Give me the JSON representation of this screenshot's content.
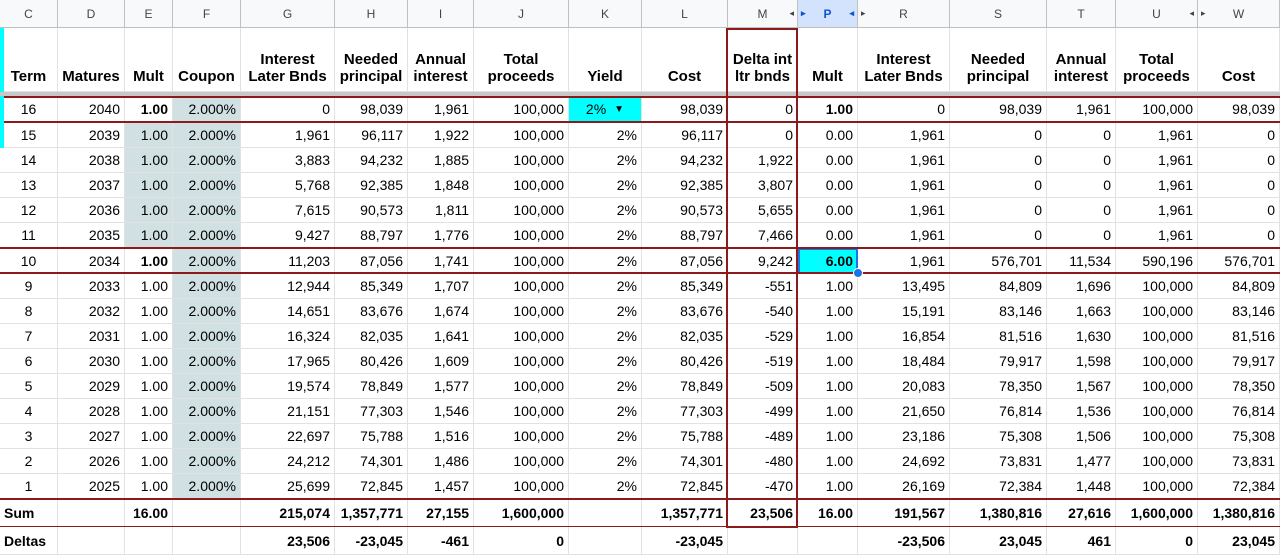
{
  "columns": [
    "C",
    "D",
    "E",
    "F",
    "G",
    "H",
    "I",
    "J",
    "K",
    "L",
    "M",
    "P",
    "R",
    "S",
    "T",
    "U",
    "W"
  ],
  "selected_column": "P",
  "headers": [
    "Term",
    "Matures",
    "Mult",
    "Coupon",
    "Interest Later Bnds",
    "Needed principal",
    "Annual interest",
    "Total proceeds",
    "Yield",
    "Cost",
    "Delta int ltr bnds",
    "Mult",
    "Interest Later Bnds",
    "Needed principal",
    "Annual interest",
    "Total proceeds",
    "Cost"
  ],
  "rows": [
    [
      "16",
      "2040",
      "1.00",
      "2.000%",
      "0",
      "98,039",
      "1,961",
      "100,000",
      "2%",
      "98,039",
      "0",
      "1.00",
      "0",
      "98,039",
      "1,961",
      "100,000",
      "98,039"
    ],
    [
      "15",
      "2039",
      "1.00",
      "2.000%",
      "1,961",
      "96,117",
      "1,922",
      "100,000",
      "2%",
      "96,117",
      "0",
      "0.00",
      "1,961",
      "0",
      "0",
      "1,961",
      "0"
    ],
    [
      "14",
      "2038",
      "1.00",
      "2.000%",
      "3,883",
      "94,232",
      "1,885",
      "100,000",
      "2%",
      "94,232",
      "1,922",
      "0.00",
      "1,961",
      "0",
      "0",
      "1,961",
      "0"
    ],
    [
      "13",
      "2037",
      "1.00",
      "2.000%",
      "5,768",
      "92,385",
      "1,848",
      "100,000",
      "2%",
      "92,385",
      "3,807",
      "0.00",
      "1,961",
      "0",
      "0",
      "1,961",
      "0"
    ],
    [
      "12",
      "2036",
      "1.00",
      "2.000%",
      "7,615",
      "90,573",
      "1,811",
      "100,000",
      "2%",
      "90,573",
      "5,655",
      "0.00",
      "1,961",
      "0",
      "0",
      "1,961",
      "0"
    ],
    [
      "11",
      "2035",
      "1.00",
      "2.000%",
      "9,427",
      "88,797",
      "1,776",
      "100,000",
      "2%",
      "88,797",
      "7,466",
      "0.00",
      "1,961",
      "0",
      "0",
      "1,961",
      "0"
    ],
    [
      "10",
      "2034",
      "1.00",
      "2.000%",
      "11,203",
      "87,056",
      "1,741",
      "100,000",
      "2%",
      "87,056",
      "9,242",
      "6.00",
      "1,961",
      "576,701",
      "11,534",
      "590,196",
      "576,701"
    ],
    [
      "9",
      "2033",
      "1.00",
      "2.000%",
      "12,944",
      "85,349",
      "1,707",
      "100,000",
      "2%",
      "85,349",
      "-551",
      "1.00",
      "13,495",
      "84,809",
      "1,696",
      "100,000",
      "84,809"
    ],
    [
      "8",
      "2032",
      "1.00",
      "2.000%",
      "14,651",
      "83,676",
      "1,674",
      "100,000",
      "2%",
      "83,676",
      "-540",
      "1.00",
      "15,191",
      "83,146",
      "1,663",
      "100,000",
      "83,146"
    ],
    [
      "7",
      "2031",
      "1.00",
      "2.000%",
      "16,324",
      "82,035",
      "1,641",
      "100,000",
      "2%",
      "82,035",
      "-529",
      "1.00",
      "16,854",
      "81,516",
      "1,630",
      "100,000",
      "81,516"
    ],
    [
      "6",
      "2030",
      "1.00",
      "2.000%",
      "17,965",
      "80,426",
      "1,609",
      "100,000",
      "2%",
      "80,426",
      "-519",
      "1.00",
      "18,484",
      "79,917",
      "1,598",
      "100,000",
      "79,917"
    ],
    [
      "5",
      "2029",
      "1.00",
      "2.000%",
      "19,574",
      "78,849",
      "1,577",
      "100,000",
      "2%",
      "78,849",
      "-509",
      "1.00",
      "20,083",
      "78,350",
      "1,567",
      "100,000",
      "78,350"
    ],
    [
      "4",
      "2028",
      "1.00",
      "2.000%",
      "21,151",
      "77,303",
      "1,546",
      "100,000",
      "2%",
      "77,303",
      "-499",
      "1.00",
      "21,650",
      "76,814",
      "1,536",
      "100,000",
      "76,814"
    ],
    [
      "3",
      "2027",
      "1.00",
      "2.000%",
      "22,697",
      "75,788",
      "1,516",
      "100,000",
      "2%",
      "75,788",
      "-489",
      "1.00",
      "23,186",
      "75,308",
      "1,506",
      "100,000",
      "75,308"
    ],
    [
      "2",
      "2026",
      "1.00",
      "2.000%",
      "24,212",
      "74,301",
      "1,486",
      "100,000",
      "2%",
      "74,301",
      "-480",
      "1.00",
      "24,692",
      "73,831",
      "1,477",
      "100,000",
      "73,831"
    ],
    [
      "1",
      "2025",
      "1.00",
      "2.000%",
      "25,699",
      "72,845",
      "1,457",
      "100,000",
      "2%",
      "72,845",
      "-470",
      "1.00",
      "26,169",
      "72,384",
      "1,448",
      "100,000",
      "72,384"
    ]
  ],
  "sum_row": [
    "Sum",
    "",
    "16.00",
    "",
    "215,074",
    "1,357,771",
    "27,155",
    "1,600,000",
    "",
    "1,357,771",
    "23,506",
    "16.00",
    "191,567",
    "1,380,816",
    "27,616",
    "1,600,000",
    "1,380,816"
  ],
  "deltas_row": [
    "Deltas",
    "",
    "",
    "",
    "23,506",
    "-23,045",
    "-461",
    "0",
    "",
    "-23,045",
    "",
    "",
    "-23,506",
    "23,045",
    "461",
    "0",
    "23,045"
  ],
  "dropdown_icon": "triangle-down-icon",
  "colors": {
    "border_red": "#8b1a1a",
    "cyan": "#00ffff",
    "shade": "#d0e0e3",
    "select_blue": "#1a73e8"
  }
}
